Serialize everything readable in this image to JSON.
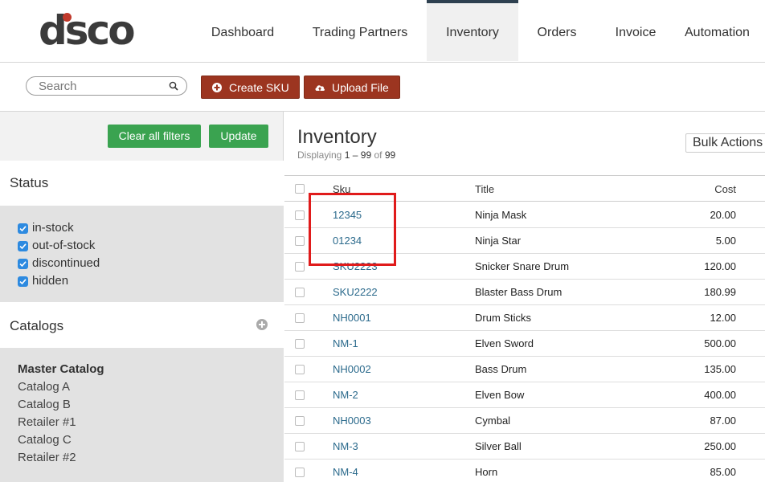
{
  "brand": {
    "logo_text": "dsco"
  },
  "nav": [
    {
      "label": "Dashboard"
    },
    {
      "label": "Trading Partners"
    },
    {
      "label": "Inventory",
      "active": true
    },
    {
      "label": "Orders"
    },
    {
      "label": "Invoice"
    },
    {
      "label": "Automation"
    }
  ],
  "toolbar": {
    "search_placeholder": "Search",
    "create_sku_label": "Create SKU",
    "upload_file_label": "Upload File"
  },
  "sidebar": {
    "clear_filters_label": "Clear all filters",
    "update_label": "Update",
    "status_title": "Status",
    "status_options": [
      {
        "label": "in-stock",
        "checked": true
      },
      {
        "label": "out-of-stock",
        "checked": true
      },
      {
        "label": "discontinued",
        "checked": true
      },
      {
        "label": "hidden",
        "checked": true
      }
    ],
    "catalogs_title": "Catalogs",
    "catalogs": [
      {
        "label": "Master Catalog",
        "bold": true
      },
      {
        "label": "Catalog A"
      },
      {
        "label": "Catalog B"
      },
      {
        "label": "Retailer #1"
      },
      {
        "label": "Catalog C"
      },
      {
        "label": "Retailer #2"
      }
    ]
  },
  "main": {
    "title": "Inventory",
    "displaying_prefix": "Displaying",
    "range_start": "1",
    "range_dash": "–",
    "range_end": "99",
    "of_word": "of",
    "total": "99",
    "bulk_actions_label": "Bulk Actions",
    "columns": {
      "sku": "Sku",
      "title": "Title",
      "cost": "Cost"
    },
    "rows": [
      {
        "sku": "12345",
        "title": "Ninja Mask",
        "cost": "20.00"
      },
      {
        "sku": "01234",
        "title": "Ninja Star",
        "cost": "5.00"
      },
      {
        "sku": "SKU2223",
        "title": "Snicker Snare Drum",
        "cost": "120.00"
      },
      {
        "sku": "SKU2222",
        "title": "Blaster Bass Drum",
        "cost": "180.99"
      },
      {
        "sku": "NH0001",
        "title": "Drum Sticks",
        "cost": "12.00"
      },
      {
        "sku": "NM-1",
        "title": "Elven Sword",
        "cost": "500.00"
      },
      {
        "sku": "NH0002",
        "title": "Bass Drum",
        "cost": "135.00"
      },
      {
        "sku": "NM-2",
        "title": "Elven Bow",
        "cost": "400.00"
      },
      {
        "sku": "NH0003",
        "title": "Cymbal",
        "cost": "87.00"
      },
      {
        "sku": "NM-3",
        "title": "Silver Ball",
        "cost": "250.00"
      },
      {
        "sku": "NM-4",
        "title": "Horn",
        "cost": "85.00"
      }
    ]
  },
  "colors": {
    "accent_red": "#9c3520",
    "accent_green": "#3aa350",
    "link_blue": "#2b6a8c",
    "nav_active_border": "#2e4050",
    "annotation_red": "#e01b1b"
  }
}
